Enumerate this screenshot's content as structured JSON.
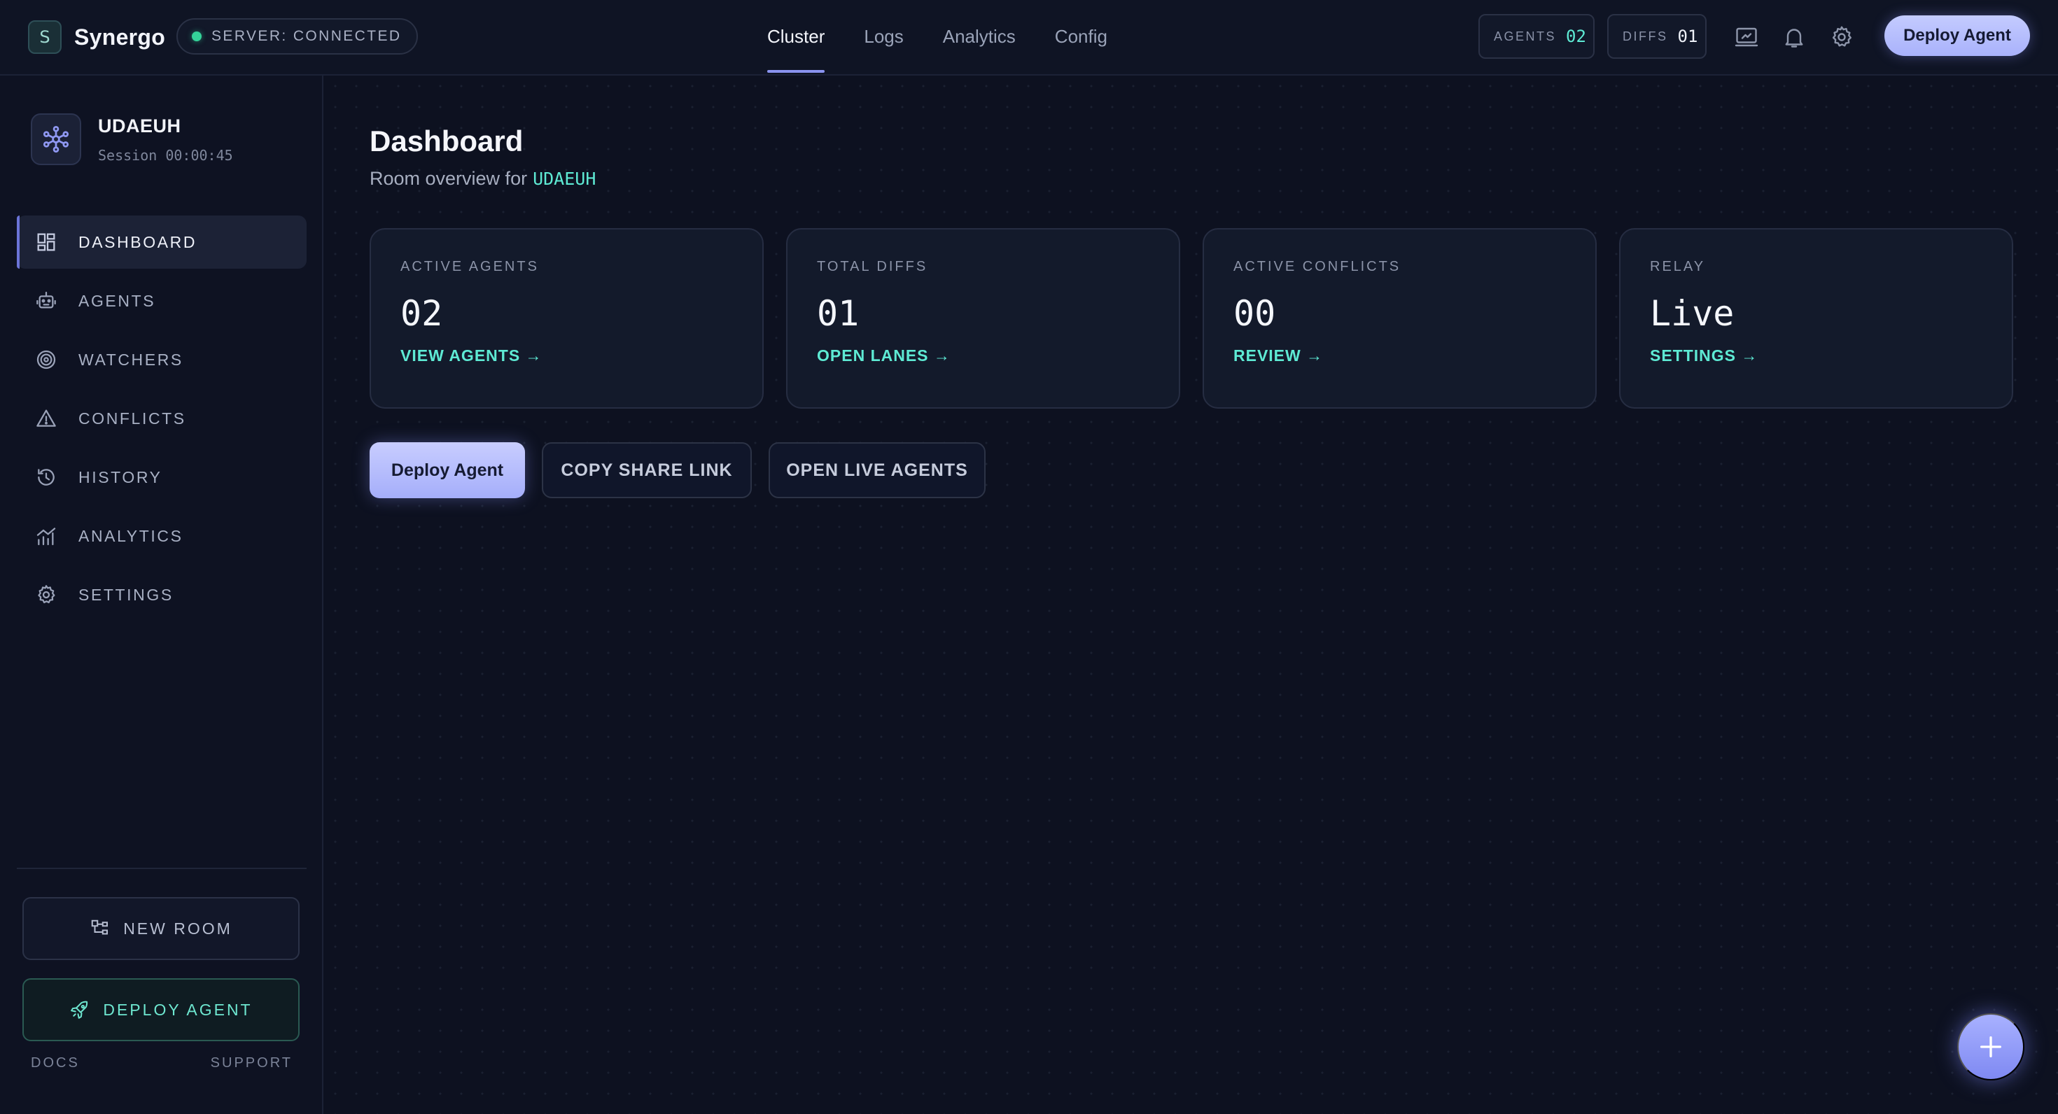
{
  "brand": {
    "badge": "S",
    "name": "Synergo"
  },
  "server_status": "SERVER: CONNECTED",
  "topnav": [
    {
      "label": "Cluster",
      "active": true
    },
    {
      "label": "Logs",
      "active": false
    },
    {
      "label": "Analytics",
      "active": false
    },
    {
      "label": "Config",
      "active": false
    }
  ],
  "counters": {
    "agents": {
      "label": "AGENTS",
      "value": "02"
    },
    "diffs": {
      "label": "DIFFS",
      "value": "01"
    }
  },
  "top_icons": [
    "screen-share-icon",
    "bell-icon",
    "gear-icon"
  ],
  "top_cta": "Deploy Agent",
  "room": {
    "name": "UDAEUH",
    "session": "Session 00:00:45"
  },
  "sidebar": {
    "items": [
      {
        "label": "DASHBOARD",
        "icon": "dashboard-icon",
        "active": true
      },
      {
        "label": "AGENTS",
        "icon": "robot-icon",
        "active": false
      },
      {
        "label": "WATCHERS",
        "icon": "radar-icon",
        "active": false
      },
      {
        "label": "CONFLICTS",
        "icon": "warning-icon",
        "active": false
      },
      {
        "label": "HISTORY",
        "icon": "history-icon",
        "active": false
      },
      {
        "label": "ANALYTICS",
        "icon": "chart-icon",
        "active": false
      },
      {
        "label": "SETTINGS",
        "icon": "gear-icon",
        "active": false
      }
    ],
    "new_room": "NEW ROOM",
    "deploy_agent": "DEPLOY AGENT",
    "docs": "DOCS",
    "support": "SUPPORT"
  },
  "main": {
    "title": "Dashboard",
    "subtitle": "Room overview for",
    "room_code": "UDAEUH",
    "cards": [
      {
        "label": "ACTIVE AGENTS",
        "value": "02",
        "link": "VIEW AGENTS →"
      },
      {
        "label": "TOTAL DIFFS",
        "value": "01",
        "link": "OPEN LANES →"
      },
      {
        "label": "ACTIVE CONFLICTS",
        "value": "00",
        "link": "REVIEW →"
      },
      {
        "label": "RELAY",
        "value": "Live",
        "link": "SETTINGS →"
      }
    ],
    "actions": {
      "deploy": "Deploy Agent",
      "share": "COPY SHARE LINK",
      "live": "OPEN LIVE AGENTS"
    }
  },
  "colors": {
    "accent": "#a9b2fb",
    "teal": "#5eead4",
    "status_green": "#34d399",
    "background": "#0d1120"
  }
}
